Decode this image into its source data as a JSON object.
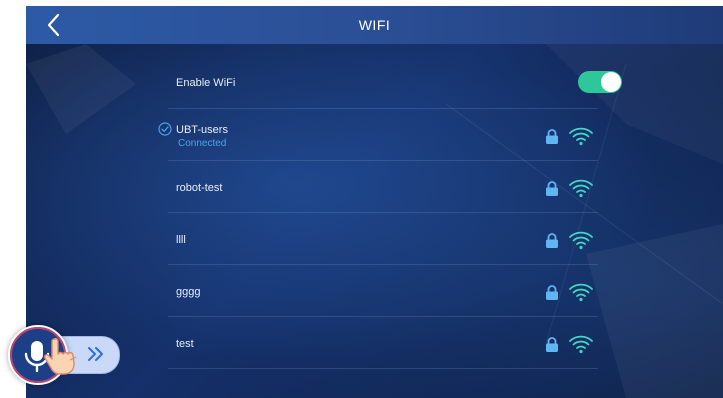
{
  "header": {
    "title": "WIFI",
    "back_icon": "chevron-left-icon"
  },
  "enable_wifi": {
    "label": "Enable WiFi",
    "enabled": true
  },
  "networks": [
    {
      "name": "UBT-users",
      "status": "Connected",
      "connected": true,
      "secured": true,
      "signal": "full"
    },
    {
      "name": "robot-test",
      "connected": false,
      "secured": true,
      "signal": "full"
    },
    {
      "name": "llll",
      "connected": false,
      "secured": true,
      "signal": "full"
    },
    {
      "name": "gggg",
      "connected": false,
      "secured": true,
      "signal": "full"
    },
    {
      "name": "test",
      "connected": false,
      "secured": true,
      "signal": "full"
    }
  ],
  "colors": {
    "accent_toggle": "#2ec79a",
    "connected_text": "#4aa3ea",
    "icon_blue": "#5fb6f2",
    "icon_teal": "#43d6c4",
    "header_bg": "#2d5aa6"
  },
  "assistant": {
    "mic_icon": "microphone-icon",
    "hand_icon": "hand-pointer-icon",
    "expand_icon": "double-chevron-right-icon"
  }
}
